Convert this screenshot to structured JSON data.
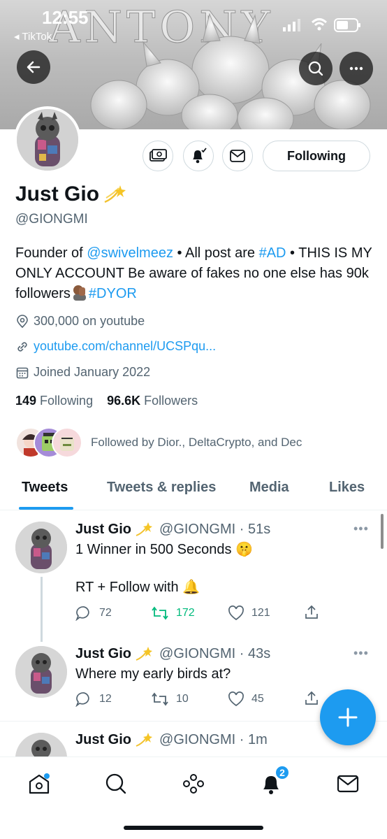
{
  "status_bar": {
    "time": "12:55",
    "back_app": "◂ TikTok"
  },
  "banner": {
    "title": "ANTONY"
  },
  "profile": {
    "display_name": "Just Gio",
    "handle": "@GIONGMI",
    "following_button": "Following",
    "bio": {
      "p1": "Founder of ",
      "mention": "@swivelmeez",
      "p2": " • All post are ",
      "hashtag_ad": "#AD",
      "p3": " • THIS IS MY ONLY ACCOUNT Be aware of fakes no one else has 90k followers",
      "hashtag_dyor": "#DYOR"
    },
    "location": "300,000 on youtube",
    "website": "youtube.com/channel/UCSPqu...",
    "joined": "Joined January 2022",
    "following_count": "149",
    "following_label": " Following",
    "followers_count": "96.6K",
    "followers_label": " Followers",
    "followed_by": "Followed by Dior., DeltaCrypto, and Dec"
  },
  "tabs": [
    {
      "label": "Tweets"
    },
    {
      "label": "Tweets & replies"
    },
    {
      "label": "Media"
    },
    {
      "label": "Likes"
    }
  ],
  "tweets": [
    {
      "name": "Just Gio",
      "handle_time": "@GIONGMI · 51s",
      "line1": "1 Winner in 500 Seconds 🤫",
      "line2": "RT + Follow with 🔔",
      "replies": "72",
      "retweets": "172",
      "likes": "121"
    },
    {
      "name": "Just Gio",
      "handle_time": "@GIONGMI · 43s",
      "line1": "Where my early birds at?",
      "replies": "12",
      "retweets": "10",
      "likes": "45"
    },
    {
      "name": "Just Gio",
      "handle_time": "@GIONGMI · 1m"
    }
  ],
  "nav": {
    "notifications_badge": "2"
  },
  "colors": {
    "accent": "#1d9bf0",
    "retweet_active": "#00ba7c",
    "text_secondary": "#536471"
  }
}
